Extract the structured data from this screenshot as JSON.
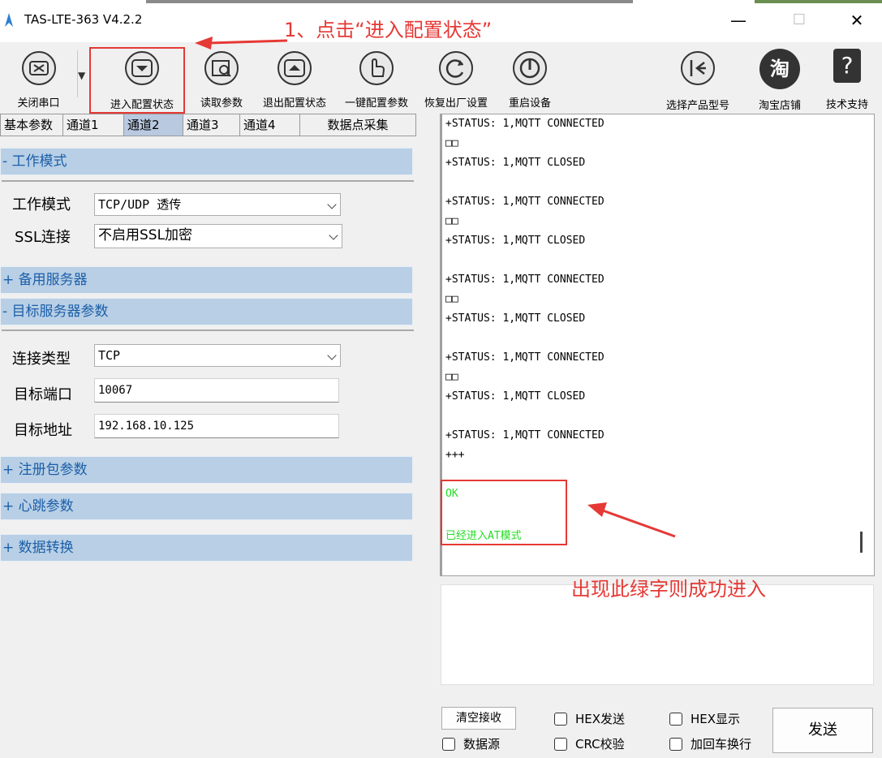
{
  "window": {
    "title": "TAS-LTE-363 V4.2.2",
    "minimize": "—",
    "maximize": "☐",
    "close": "✕"
  },
  "toolbar": {
    "close_port": "关闭串口",
    "enter_config": "进入配置状态",
    "read_params": "读取参数",
    "exit_config": "退出配置状态",
    "one_key_config": "一键配置参数",
    "factory_reset": "恢复出厂设置",
    "reboot": "重启设备",
    "select_model": "选择产品型号",
    "taobao": "淘宝店铺",
    "support": "技术支持",
    "taobao_glyph": "淘",
    "support_glyph": "?"
  },
  "tabs": [
    "基本参数",
    "通道1",
    "通道2",
    "通道3",
    "通道4",
    "数据点采集"
  ],
  "left": {
    "work_mode_header": "- 工作模式",
    "work_mode_label": "工作模式",
    "work_mode_value": "TCP/UDP 透传",
    "ssl_label": "SSL连接",
    "ssl_value": "不启用SSL加密",
    "backup_server_header": "+ 备用服务器",
    "target_server_header": "- 目标服务器参数",
    "conn_type_label": "连接类型",
    "conn_type_value": "TCP",
    "port_label": "目标端口",
    "port_value": "10067",
    "addr_label": "目标地址",
    "addr_value": "192.168.10.125",
    "register_header": "+ 注册包参数",
    "heartbeat_header": "+ 心跳参数",
    "data_convert_header": "+ 数据转换"
  },
  "log": {
    "lines": [
      "+STATUS: 1,MQTT CONNECTED",
      "□□",
      "+STATUS: 1,MQTT CLOSED",
      "",
      "+STATUS: 1,MQTT CONNECTED",
      "□□",
      "+STATUS: 1,MQTT CLOSED",
      "",
      "+STATUS: 1,MQTT CONNECTED",
      "□□",
      "+STATUS: 1,MQTT CLOSED",
      "",
      "+STATUS: 1,MQTT CONNECTED",
      "□□",
      "+STATUS: 1,MQTT CLOSED",
      "",
      "+STATUS: 1,MQTT CONNECTED",
      "+++",
      "",
      "OK",
      "",
      "已经进入AT模式"
    ]
  },
  "annotations": {
    "step1": "1、点击“进入配置状态”",
    "success": "出现此绿字则成功进入"
  },
  "bottom": {
    "clear_recv": "清空接收",
    "data_source": "数据源",
    "hex_send": "HEX发送",
    "crc_check": "CRC校验",
    "hex_display": "HEX显示",
    "add_crlf": "加回车换行",
    "send": "发送"
  },
  "colors": {
    "accent": "#1c5fa8",
    "annotation": "#e53935",
    "success_text": "#22dd22",
    "section_header": "#b8cfe6"
  }
}
